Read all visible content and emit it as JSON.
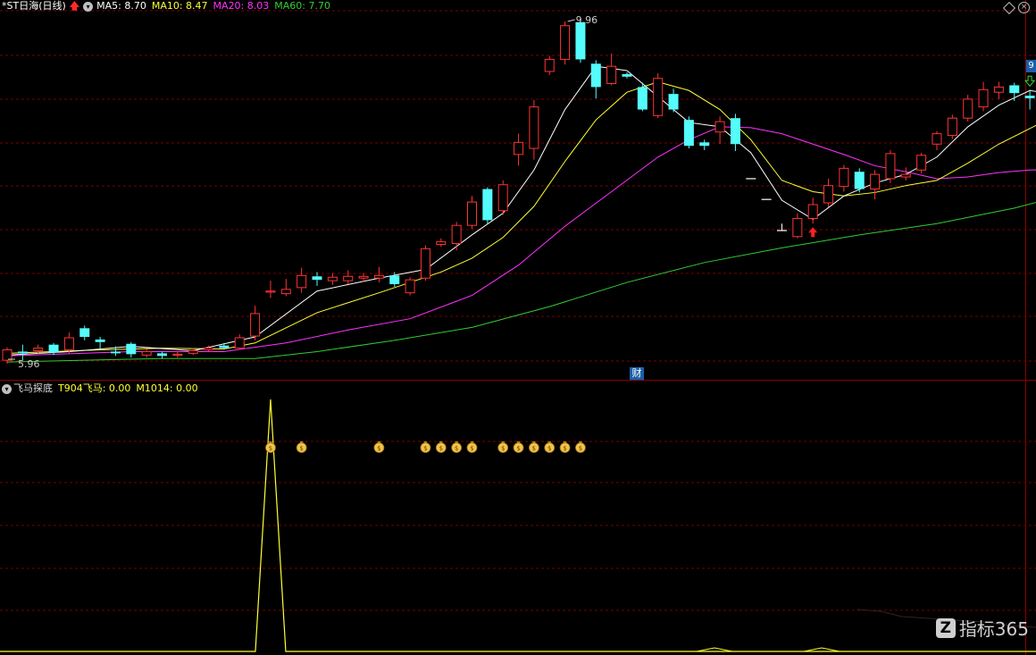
{
  "main_chart": {
    "stock_name": "*ST日海",
    "period": "(日线)",
    "ma5_label": "MA5: 8.70",
    "ma10_label": "MA10: 8.47",
    "ma20_label": "MA20: 8.03",
    "ma60_label": "MA60: 7.70",
    "high_marker": "9.96",
    "low_marker": "5.96",
    "finance_badge": "财",
    "right_edge_tag": "9",
    "colors": {
      "ma5": "#ffffff",
      "ma10": "#ffff33",
      "ma20": "#ff33ff",
      "ma60": "#33cc33",
      "up": "#ff3333",
      "down": "#54fcfc",
      "grid": "#7a0000"
    }
  },
  "indicator_panel": {
    "name": "飞马探底",
    "t904_label": "T904飞马: 0.00",
    "m1014_label": "M1014: 0.00",
    "money_bag_icon": "money-bag-icon",
    "signal_count": 14
  },
  "watermark": {
    "logo_letter": "Z",
    "text": "指标365"
  },
  "chart_data": {
    "type": "candlestick",
    "price_range": [
      5.96,
      9.96
    ],
    "ma_labels": {
      "MA5": 8.7,
      "MA10": 8.47,
      "MA20": 8.03,
      "MA60": 7.7
    },
    "candles": [
      {
        "o": 6.0,
        "c": 6.12,
        "h": 6.15,
        "l": 5.96,
        "dir": "up"
      },
      {
        "o": 6.08,
        "c": 6.1,
        "h": 6.18,
        "l": 6.0,
        "dir": "down"
      },
      {
        "o": 6.11,
        "c": 6.14,
        "h": 6.18,
        "l": 6.06,
        "dir": "up"
      },
      {
        "o": 6.18,
        "c": 6.09,
        "h": 6.2,
        "l": 6.06,
        "dir": "down"
      },
      {
        "o": 6.12,
        "c": 6.26,
        "h": 6.32,
        "l": 6.08,
        "dir": "up"
      },
      {
        "o": 6.37,
        "c": 6.27,
        "h": 6.4,
        "l": 6.23,
        "dir": "down"
      },
      {
        "o": 6.24,
        "c": 6.21,
        "h": 6.27,
        "l": 6.13,
        "dir": "down"
      },
      {
        "o": 6.1,
        "c": 6.08,
        "h": 6.16,
        "l": 6.05,
        "dir": "down"
      },
      {
        "o": 6.19,
        "c": 6.07,
        "h": 6.21,
        "l": 6.03,
        "dir": "down"
      },
      {
        "o": 6.06,
        "c": 6.1,
        "h": 6.13,
        "l": 6.03,
        "dir": "up"
      },
      {
        "o": 6.08,
        "c": 6.05,
        "h": 6.1,
        "l": 6.02,
        "dir": "down"
      },
      {
        "o": 6.06,
        "c": 6.07,
        "h": 6.1,
        "l": 6.03,
        "dir": "up"
      },
      {
        "o": 6.08,
        "c": 6.11,
        "h": 6.14,
        "l": 6.06,
        "dir": "up"
      },
      {
        "o": 6.12,
        "c": 6.14,
        "h": 6.17,
        "l": 6.1,
        "dir": "up"
      },
      {
        "o": 6.17,
        "c": 6.14,
        "h": 6.2,
        "l": 6.13,
        "dir": "down"
      },
      {
        "o": 6.14,
        "c": 6.26,
        "h": 6.3,
        "l": 6.12,
        "dir": "up"
      },
      {
        "o": 6.28,
        "c": 6.54,
        "h": 6.63,
        "l": 6.23,
        "dir": "up"
      },
      {
        "o": 6.8,
        "c": 6.8,
        "h": 6.92,
        "l": 6.72,
        "dir": "up"
      },
      {
        "o": 6.77,
        "c": 6.82,
        "h": 6.94,
        "l": 6.74,
        "dir": "up"
      },
      {
        "o": 6.84,
        "c": 6.98,
        "h": 7.07,
        "l": 6.78,
        "dir": "up"
      },
      {
        "o": 6.97,
        "c": 6.93,
        "h": 7.02,
        "l": 6.86,
        "dir": "down"
      },
      {
        "o": 6.92,
        "c": 6.96,
        "h": 7.01,
        "l": 6.87,
        "dir": "up"
      },
      {
        "o": 6.92,
        "c": 6.97,
        "h": 7.04,
        "l": 6.88,
        "dir": "up"
      },
      {
        "o": 6.95,
        "c": 6.97,
        "h": 7.01,
        "l": 6.91,
        "dir": "up"
      },
      {
        "o": 6.95,
        "c": 6.98,
        "h": 7.08,
        "l": 6.9,
        "dir": "up"
      },
      {
        "o": 6.98,
        "c": 6.88,
        "h": 7.02,
        "l": 6.85,
        "dir": "down"
      },
      {
        "o": 6.78,
        "c": 6.93,
        "h": 6.96,
        "l": 6.75,
        "dir": "up"
      },
      {
        "o": 6.95,
        "c": 7.29,
        "h": 7.33,
        "l": 6.92,
        "dir": "up"
      },
      {
        "o": 7.34,
        "c": 7.37,
        "h": 7.41,
        "l": 7.31,
        "dir": "up"
      },
      {
        "o": 7.35,
        "c": 7.56,
        "h": 7.6,
        "l": 7.27,
        "dir": "up"
      },
      {
        "o": 7.56,
        "c": 7.83,
        "h": 7.9,
        "l": 7.52,
        "dir": "up"
      },
      {
        "o": 7.98,
        "c": 7.62,
        "h": 8.0,
        "l": 7.58,
        "dir": "down"
      },
      {
        "o": 7.73,
        "c": 8.03,
        "h": 8.08,
        "l": 7.68,
        "dir": "up"
      },
      {
        "o": 8.38,
        "c": 8.52,
        "h": 8.62,
        "l": 8.25,
        "dir": "up"
      },
      {
        "o": 8.45,
        "c": 8.93,
        "h": 9.01,
        "l": 8.32,
        "dir": "up"
      },
      {
        "o": 9.34,
        "c": 9.48,
        "h": 9.52,
        "l": 9.3,
        "dir": "up"
      },
      {
        "o": 9.48,
        "c": 9.87,
        "h": 9.92,
        "l": 9.42,
        "dir": "up"
      },
      {
        "o": 9.91,
        "c": 9.48,
        "h": 9.96,
        "l": 9.44,
        "dir": "down"
      },
      {
        "o": 9.43,
        "c": 9.16,
        "h": 9.47,
        "l": 9.03,
        "dir": "down"
      },
      {
        "o": 9.2,
        "c": 9.4,
        "h": 9.55,
        "l": 9.18,
        "dir": "up"
      },
      {
        "o": 9.31,
        "c": 9.28,
        "h": 9.33,
        "l": 9.26,
        "dir": "down"
      },
      {
        "o": 9.16,
        "c": 8.9,
        "h": 9.21,
        "l": 8.88,
        "dir": "down"
      },
      {
        "o": 8.83,
        "c": 9.26,
        "h": 9.32,
        "l": 8.8,
        "dir": "up"
      },
      {
        "o": 9.08,
        "c": 8.9,
        "h": 9.14,
        "l": 8.87,
        "dir": "down"
      },
      {
        "o": 8.78,
        "c": 8.48,
        "h": 8.82,
        "l": 8.45,
        "dir": "down"
      },
      {
        "o": 8.52,
        "c": 8.48,
        "h": 8.55,
        "l": 8.43,
        "dir": "down"
      },
      {
        "o": 8.64,
        "c": 8.76,
        "h": 8.82,
        "l": 8.5,
        "dir": "up"
      },
      {
        "o": 8.8,
        "c": 8.5,
        "h": 8.85,
        "l": 8.42,
        "dir": "down"
      },
      {
        "o": 8.1,
        "c": 8.1,
        "h": 8.1,
        "l": 8.1,
        "dir": "flat"
      },
      {
        "o": 7.86,
        "c": 7.86,
        "h": 7.86,
        "l": 7.86,
        "dir": "flat"
      },
      {
        "o": 7.5,
        "c": 7.5,
        "h": 7.58,
        "l": 7.5,
        "dir": "flat"
      },
      {
        "o": 7.43,
        "c": 7.64,
        "h": 7.7,
        "l": 7.41,
        "dir": "up"
      },
      {
        "o": 7.64,
        "c": 7.8,
        "h": 7.88,
        "l": 7.58,
        "dir": "up"
      },
      {
        "o": 7.82,
        "c": 8.02,
        "h": 8.1,
        "l": 7.77,
        "dir": "up"
      },
      {
        "o": 8.01,
        "c": 8.22,
        "h": 8.26,
        "l": 7.95,
        "dir": "up"
      },
      {
        "o": 8.18,
        "c": 7.98,
        "h": 8.22,
        "l": 7.94,
        "dir": "down"
      },
      {
        "o": 7.98,
        "c": 8.15,
        "h": 8.2,
        "l": 7.86,
        "dir": "up"
      },
      {
        "o": 8.1,
        "c": 8.39,
        "h": 8.43,
        "l": 8.05,
        "dir": "up"
      },
      {
        "o": 8.12,
        "c": 8.15,
        "h": 8.23,
        "l": 8.08,
        "dir": "up"
      },
      {
        "o": 8.2,
        "c": 8.37,
        "h": 8.4,
        "l": 8.16,
        "dir": "up"
      },
      {
        "o": 8.5,
        "c": 8.62,
        "h": 8.65,
        "l": 8.43,
        "dir": "up"
      },
      {
        "o": 8.6,
        "c": 8.8,
        "h": 8.84,
        "l": 8.56,
        "dir": "up"
      },
      {
        "o": 8.8,
        "c": 9.02,
        "h": 9.07,
        "l": 8.76,
        "dir": "up"
      },
      {
        "o": 8.93,
        "c": 9.13,
        "h": 9.22,
        "l": 8.88,
        "dir": "up"
      },
      {
        "o": 9.1,
        "c": 9.16,
        "h": 9.22,
        "l": 9.02,
        "dir": "up"
      },
      {
        "o": 9.18,
        "c": 9.09,
        "h": 9.21,
        "l": 9.0,
        "dir": "down"
      },
      {
        "o": 9.06,
        "c": 9.03,
        "h": 9.13,
        "l": 8.9,
        "dir": "down"
      },
      {
        "o": 9.04,
        "c": 9.01,
        "h": 9.12,
        "l": 8.82,
        "dir": "down"
      }
    ],
    "ma5": [
      [
        0,
        6.06
      ],
      [
        4,
        6.1
      ],
      [
        8,
        6.16
      ],
      [
        12,
        6.11
      ],
      [
        16,
        6.27
      ],
      [
        20,
        6.8
      ],
      [
        24,
        6.95
      ],
      [
        27,
        7.05
      ],
      [
        30,
        7.45
      ],
      [
        32,
        7.7
      ],
      [
        34,
        8.2
      ],
      [
        36,
        8.9
      ],
      [
        38,
        9.4
      ],
      [
        40,
        9.35
      ],
      [
        42,
        9.05
      ],
      [
        44,
        8.75
      ],
      [
        46,
        8.7
      ],
      [
        48,
        8.4
      ],
      [
        50,
        7.85
      ],
      [
        52,
        7.63
      ],
      [
        54,
        7.9
      ],
      [
        56,
        8.05
      ],
      [
        58,
        8.15
      ],
      [
        60,
        8.35
      ],
      [
        62,
        8.7
      ],
      [
        64,
        8.95
      ],
      [
        66,
        9.12
      ],
      [
        68,
        9.06
      ]
    ],
    "ma10": [
      [
        0,
        6.08
      ],
      [
        6,
        6.12
      ],
      [
        10,
        6.14
      ],
      [
        14,
        6.13
      ],
      [
        16,
        6.2
      ],
      [
        20,
        6.55
      ],
      [
        24,
        6.78
      ],
      [
        28,
        7.02
      ],
      [
        30,
        7.18
      ],
      [
        32,
        7.42
      ],
      [
        34,
        7.78
      ],
      [
        36,
        8.3
      ],
      [
        38,
        8.78
      ],
      [
        40,
        9.1
      ],
      [
        42,
        9.22
      ],
      [
        44,
        9.12
      ],
      [
        46,
        8.9
      ],
      [
        48,
        8.55
      ],
      [
        50,
        8.08
      ],
      [
        52,
        7.95
      ],
      [
        54,
        7.9
      ],
      [
        56,
        7.94
      ],
      [
        58,
        8.02
      ],
      [
        60,
        8.08
      ],
      [
        62,
        8.28
      ],
      [
        64,
        8.5
      ],
      [
        66,
        8.68
      ],
      [
        68,
        8.86
      ]
    ],
    "ma20": [
      [
        0,
        6.05
      ],
      [
        8,
        6.1
      ],
      [
        14,
        6.1
      ],
      [
        18,
        6.2
      ],
      [
        22,
        6.35
      ],
      [
        26,
        6.48
      ],
      [
        30,
        6.75
      ],
      [
        33,
        7.1
      ],
      [
        36,
        7.55
      ],
      [
        39,
        7.95
      ],
      [
        42,
        8.35
      ],
      [
        44,
        8.55
      ],
      [
        46,
        8.7
      ],
      [
        48,
        8.69
      ],
      [
        50,
        8.62
      ],
      [
        52,
        8.5
      ],
      [
        54,
        8.38
      ],
      [
        56,
        8.25
      ],
      [
        58,
        8.18
      ],
      [
        60,
        8.1
      ],
      [
        62,
        8.12
      ],
      [
        64,
        8.17
      ],
      [
        66,
        8.2
      ],
      [
        68,
        8.21
      ]
    ],
    "ma60": [
      [
        0,
        5.98
      ],
      [
        10,
        6.02
      ],
      [
        16,
        6.02
      ],
      [
        20,
        6.1
      ],
      [
        25,
        6.23
      ],
      [
        30,
        6.38
      ],
      [
        35,
        6.62
      ],
      [
        40,
        6.9
      ],
      [
        45,
        7.13
      ],
      [
        50,
        7.3
      ],
      [
        55,
        7.45
      ],
      [
        60,
        7.58
      ],
      [
        65,
        7.76
      ],
      [
        68,
        7.9
      ]
    ],
    "indicator_spike": {
      "x_index": 17,
      "value": 1.0
    },
    "buy_signal_candle": 52,
    "sell_signal_candle": 66
  }
}
